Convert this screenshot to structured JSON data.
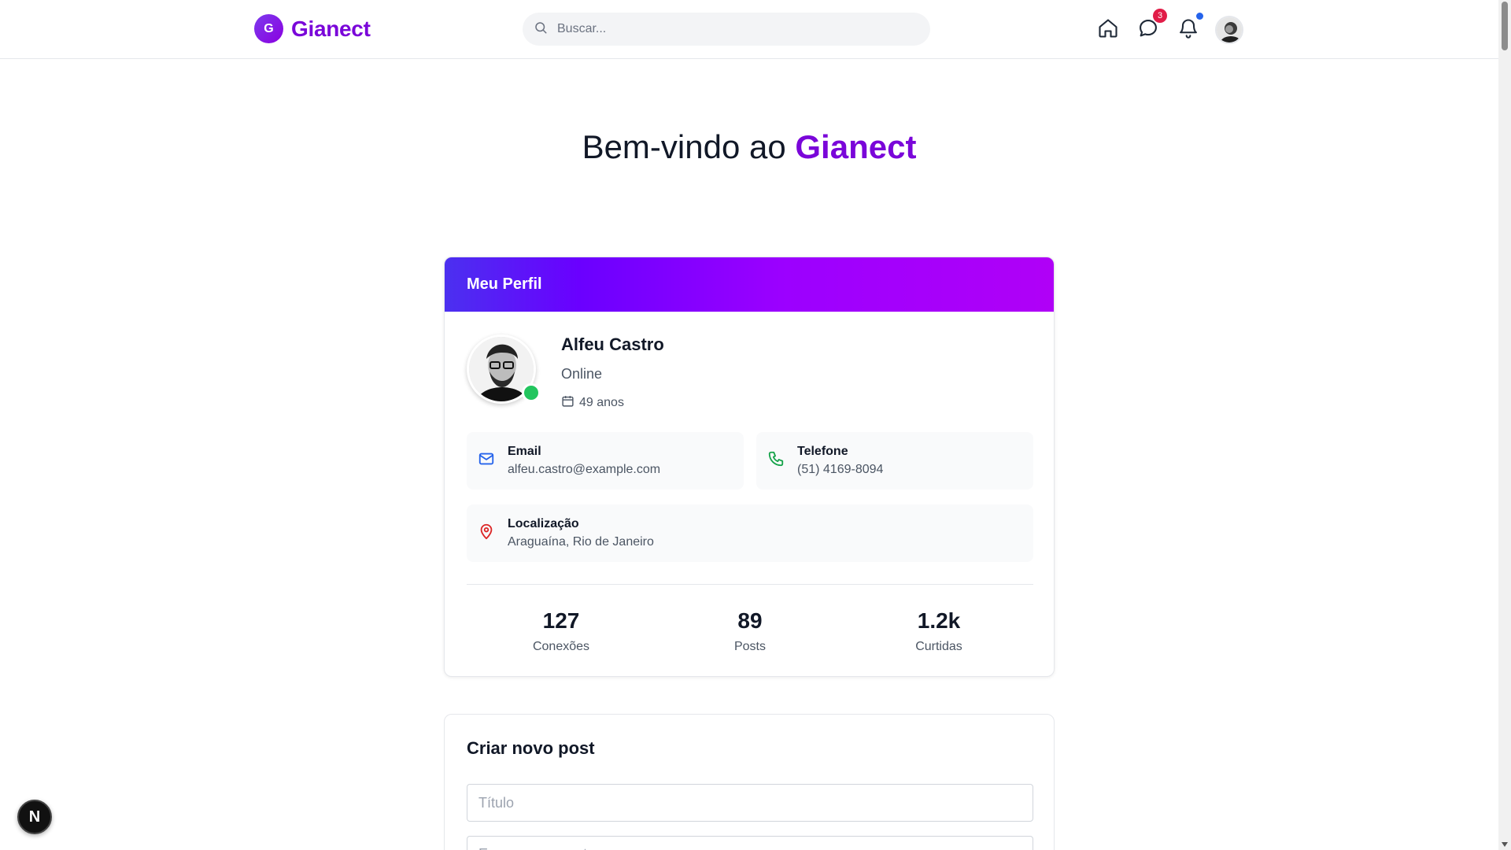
{
  "header": {
    "brand_initial": "G",
    "brand_name": "Gianect",
    "search_placeholder": "Buscar...",
    "messages_badge": "3"
  },
  "welcome": {
    "prefix": "Bem-vindo ao ",
    "accent": "Gianect"
  },
  "profile": {
    "heading": "Meu Perfil",
    "name": "Alfeu Castro",
    "status": "Online",
    "age": "49 anos",
    "email_label": "Email",
    "email_value": "alfeu.castro@example.com",
    "phone_label": "Telefone",
    "phone_value": "(51) 4169-8094",
    "location_label": "Localização",
    "location_value": "Araguaína, Rio de Janeiro",
    "stats": [
      {
        "value": "127",
        "label": "Conexões"
      },
      {
        "value": "89",
        "label": "Posts"
      },
      {
        "value": "1.2k",
        "label": "Curtidas"
      }
    ]
  },
  "create_post": {
    "heading": "Criar novo post",
    "title_placeholder": "Título",
    "content_placeholder": "Escreva seu post..."
  },
  "dev_button_label": "N",
  "colors": {
    "brand": "#7a06d9",
    "online": "#22c55e",
    "badge": "#e11d48",
    "notification_dot": "#2563eb"
  }
}
